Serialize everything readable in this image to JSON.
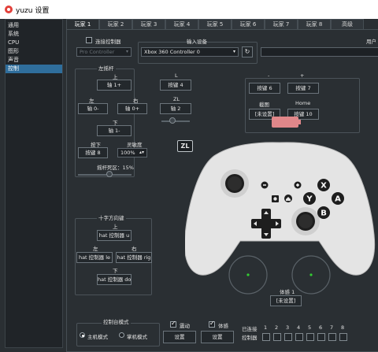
{
  "window": {
    "title": "yuzu 设置"
  },
  "sidebar": {
    "items": [
      {
        "label": "通用"
      },
      {
        "label": "系统"
      },
      {
        "label": "CPU"
      },
      {
        "label": "图形"
      },
      {
        "label": "声音"
      },
      {
        "label": "控制"
      }
    ],
    "active": 5
  },
  "tabs": [
    "玩家 1",
    "玩家 2",
    "玩家 3",
    "玩家 4",
    "玩家 5",
    "玩家 6",
    "玩家 7",
    "玩家 8",
    "高级"
  ],
  "connect": {
    "label": "连接控制器",
    "controller_type": "Pro Controller"
  },
  "input_device": {
    "label": "输入设备",
    "value": "Xbox 360 Controller 0",
    "refresh_icon": "refresh-icon"
  },
  "user_profile": {
    "label": "用户"
  },
  "left_stick": {
    "title": "左摇杆",
    "up_label": "上",
    "up_value": "轴 1+",
    "left_label": "左",
    "left_value": "轴 0-",
    "right_label": "右",
    "right_value": "轴 0+",
    "down_label": "下",
    "down_value": "轴 1-",
    "press_label": "按下",
    "press_value": "按键 8",
    "sensitivity_label": "灵敏度",
    "sensitivity_value": "100%",
    "deadzone_label": "摇杆死区：15%",
    "deadzone_value": 15
  },
  "l_button": {
    "l_label": "L",
    "l_value": "按键 4",
    "zl_label": "ZL",
    "zl_value": "轴 2",
    "zl_badge": "ZL"
  },
  "top_right": {
    "minus_label": "-",
    "minus_value": "按键 6",
    "plus_label": "+",
    "plus_value": "按键 7",
    "capture_label": "截图",
    "capture_value": "[未设置]",
    "home_label": "Home",
    "home_value": "按键 10"
  },
  "dpad": {
    "title": "十字方向键",
    "up_label": "上",
    "up_value": "hat 控制器 u",
    "left_label": "左",
    "left_value": "hat 控制器 le",
    "right_label": "右",
    "right_value": "hat 控制器 rig",
    "down_label": "下",
    "down_value": "hat 控制器 dov"
  },
  "controller": {
    "buttons": {
      "x": "X",
      "y": "Y",
      "a": "A",
      "b": "B"
    }
  },
  "motion": {
    "label": "体感 1",
    "value": "[未设置]"
  },
  "console_mode": {
    "title": "控制台模式",
    "host_label": "主机模式",
    "handheld_label": "掌机模式",
    "selected": "host"
  },
  "vibration": {
    "label": "震动",
    "checked": true,
    "button": "设置"
  },
  "motion_settings": {
    "label": "体感",
    "checked": true,
    "button": "设置"
  },
  "connected": {
    "label_line1": "已连接",
    "label_line2": "控制器",
    "players": [
      "1",
      "2",
      "3",
      "4",
      "5",
      "6",
      "7",
      "8"
    ]
  },
  "colors": {
    "accent": "#2f6e9c",
    "controller_body": "#e4e4e4",
    "battery": "#e0878a"
  }
}
